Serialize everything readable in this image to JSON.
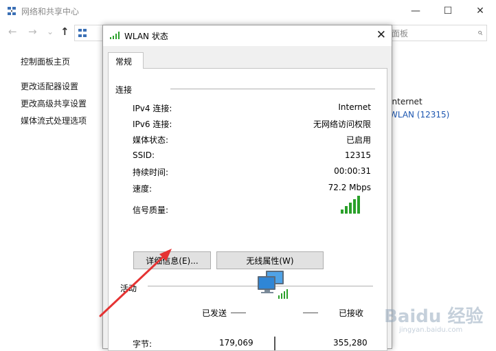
{
  "background_window": {
    "title": "网络和共享中心",
    "caption_buttons": {
      "minimize": "—",
      "maximize": "☐",
      "close": "✕"
    },
    "nav": {
      "back": "←",
      "forward": "→",
      "dropdown": "⌄",
      "up": "↑"
    },
    "search_placeholder_fragment": "面板",
    "sidebar": {
      "home": "控制面板主页",
      "items": [
        "更改适配器设置",
        "更改高级共享设置",
        "媒体流式处理选项"
      ]
    },
    "right": {
      "access_type": "Internet",
      "connection_link": "WLAN (12315)"
    }
  },
  "dialog": {
    "title": "WLAN 状态",
    "close": "✕",
    "tab": "常规",
    "connection": {
      "group_title": "连接",
      "rows": [
        {
          "label": "IPv4 连接:",
          "value": "Internet"
        },
        {
          "label": "IPv6 连接:",
          "value": "无网络访问权限"
        },
        {
          "label": "媒体状态:",
          "value": "已启用"
        },
        {
          "label": "SSID:",
          "value": "12315"
        },
        {
          "label": "持续时间:",
          "value": "00:00:31"
        },
        {
          "label": "速度:",
          "value": "72.2 Mbps"
        }
      ],
      "signal_label": "信号质量:",
      "signal_bars": 5
    },
    "buttons": {
      "details": "详细信息(E)...",
      "wireless_props": "无线属性(W)"
    },
    "activity": {
      "group_title": "活动",
      "sent_label": "已发送",
      "received_label": "已接收",
      "bytes_label": "字节:",
      "bytes_sent": "179,069",
      "bytes_received": "355,280"
    }
  },
  "watermark": {
    "main": "Baidu 经验",
    "sub": "jingyan.baidu.com"
  },
  "colors": {
    "link": "#1c56b0",
    "signal": "#2aa02a",
    "arrow": "#e53333",
    "dialog_bg": "#f0f0f0",
    "button": "#e1e1e1"
  }
}
